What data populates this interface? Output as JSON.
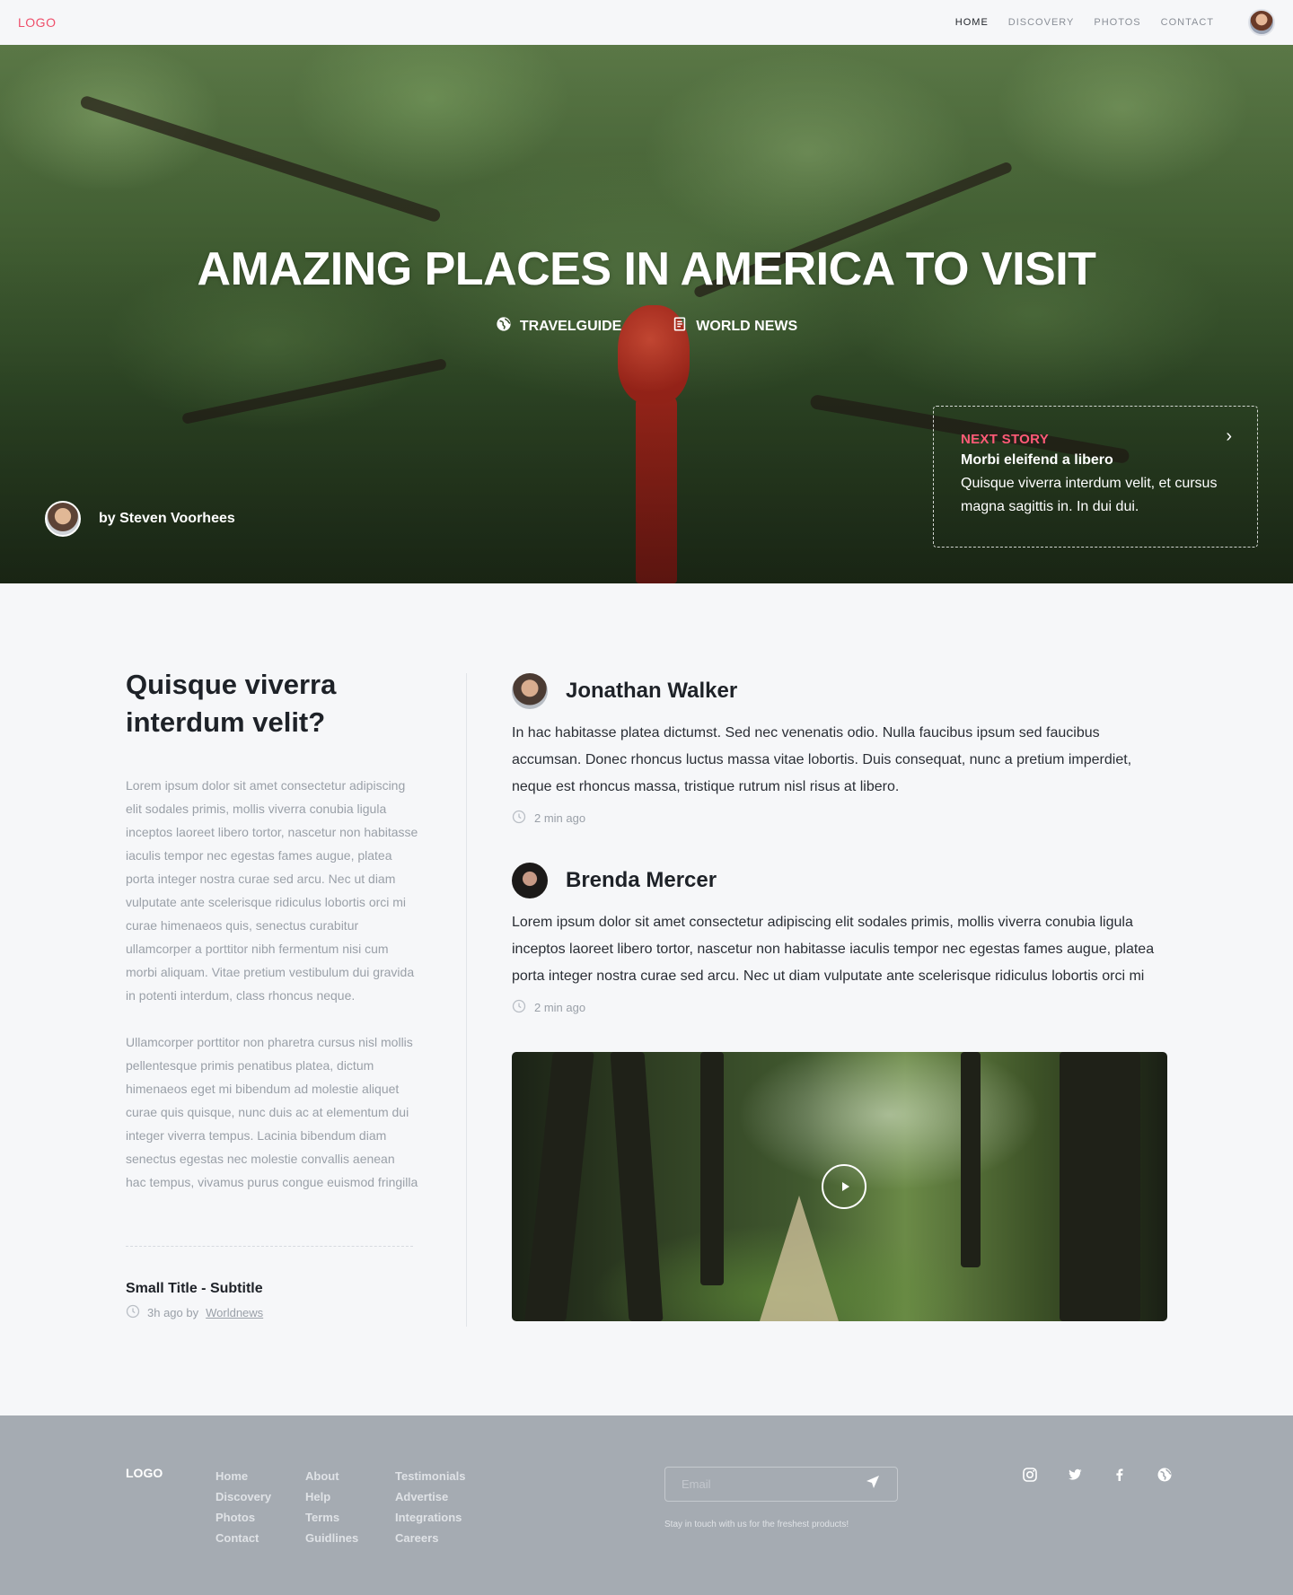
{
  "nav": {
    "logo": "LOGO",
    "links": [
      "HOME",
      "DISCOVERY",
      "PHOTOS",
      "CONTACT"
    ],
    "active": "HOME"
  },
  "hero": {
    "title": "AMAZING PLACES IN AMERICA TO VISIT",
    "tags": [
      {
        "label": "TRAVELGUIDE",
        "icon": "globe-icon"
      },
      {
        "label": "WORLD NEWS",
        "icon": "document-icon"
      }
    ],
    "author": "by Steven Voorhees",
    "next_story": {
      "label": "NEXT STORY",
      "title": "Morbi eleifend a libero",
      "text": "Quisque viverra interdum velit, et cursus magna sagittis in. In dui dui."
    }
  },
  "article": {
    "title": "Quisque viverra interdum velit?",
    "paragraphs": [
      "Lorem ipsum dolor sit amet consectetur adipiscing elit sodales primis, mollis viverra conubia ligula inceptos laoreet libero tortor, nascetur non habitasse iaculis tempor nec egestas fames augue, platea porta integer nostra curae sed arcu. Nec ut diam vulputate ante scelerisque ridiculus lobortis orci mi curae himenaeos quis, senectus curabitur ullamcorper a porttitor nibh fermentum nisi cum morbi aliquam. Vitae pretium vestibulum dui gravida in potenti interdum, class rhoncus neque.",
      "Ullamcorper porttitor non pharetra cursus nisl mollis pellentesque primis penatibus platea, dictum himenaeos eget mi bibendum ad molestie aliquet curae quis quisque, nunc duis ac at elementum dui integer viverra tempus. Lacinia bibendum diam senectus egestas nec molestie convallis aenean hac tempus, vivamus purus congue euismod fringilla"
    ],
    "small_title": "Small Title - Subtitle",
    "small_meta": "3h ago by",
    "small_meta_link": "Worldnews"
  },
  "comments": [
    {
      "name": "Jonathan Walker",
      "text": "In hac habitasse platea dictumst. Sed nec venenatis odio. Nulla faucibus ipsum sed faucibus accumsan. Donec rhoncus luctus massa vitae lobortis. Duis consequat, nunc a pretium imperdiet, neque est rhoncus massa, tristique rutrum nisl risus at libero.",
      "time": "2 min ago"
    },
    {
      "name": "Brenda Mercer",
      "text": "Lorem ipsum dolor sit amet consectetur adipiscing elit sodales primis, mollis viverra conubia ligula inceptos laoreet libero tortor, nascetur non habitasse iaculis tempor nec egestas fames augue, platea porta integer nostra curae sed arcu. Nec ut diam vulputate ante scelerisque ridiculus lobortis orci mi",
      "time": "2 min ago"
    }
  ],
  "footer": {
    "logo": "LOGO",
    "columns": [
      [
        "Home",
        "Discovery",
        "Photos",
        "Contact"
      ],
      [
        "About",
        "Help",
        "Terms",
        "Guidlines"
      ],
      [
        "Testimonials",
        "Advertise",
        "Integrations",
        "Careers"
      ]
    ],
    "email_placeholder": "Email",
    "note": "Stay in touch with us for the freshest products!",
    "socials": [
      "instagram-icon",
      "twitter-icon",
      "facebook-icon",
      "globe-icon"
    ]
  },
  "colors": {
    "accent": "#ef4f6b",
    "background": "#f6f7f9",
    "footer": "#a5abb2"
  }
}
